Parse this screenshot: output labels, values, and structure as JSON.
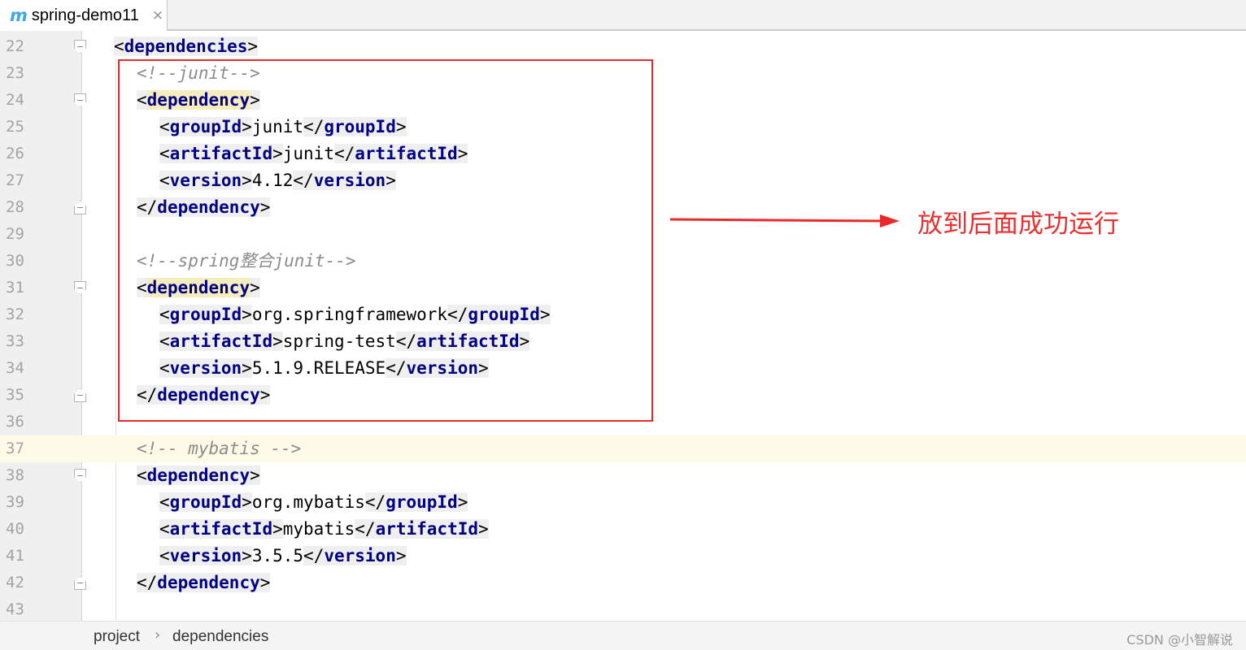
{
  "tab": {
    "logo": "m",
    "title": "spring-demo11",
    "close": "×"
  },
  "lines": [
    {
      "num": "22",
      "indent": 1,
      "fold": "open",
      "kind": "open",
      "tag": "dependencies"
    },
    {
      "num": "23",
      "indent": 2,
      "kind": "comment",
      "text": "<!--junit-->"
    },
    {
      "num": "24",
      "indent": 2,
      "fold": "open",
      "kind": "open",
      "tag": "dependency",
      "match": true
    },
    {
      "num": "25",
      "indent": 3,
      "kind": "element",
      "tag": "groupId",
      "text": "junit"
    },
    {
      "num": "26",
      "indent": 3,
      "kind": "element",
      "tag": "artifactId",
      "text": "junit"
    },
    {
      "num": "27",
      "indent": 3,
      "kind": "element",
      "tag": "version",
      "text": "4.12"
    },
    {
      "num": "28",
      "indent": 2,
      "fold": "close",
      "kind": "close",
      "tag": "dependency"
    },
    {
      "num": "29",
      "kind": "blank"
    },
    {
      "num": "30",
      "indent": 2,
      "kind": "comment",
      "text": "<!--spring整合junit-->"
    },
    {
      "num": "31",
      "indent": 2,
      "fold": "open",
      "kind": "open",
      "tag": "dependency",
      "match": true
    },
    {
      "num": "32",
      "indent": 3,
      "kind": "element",
      "tag": "groupId",
      "text": "org.springframework"
    },
    {
      "num": "33",
      "indent": 3,
      "kind": "element",
      "tag": "artifactId",
      "text": "spring-test"
    },
    {
      "num": "34",
      "indent": 3,
      "kind": "element",
      "tag": "version",
      "text": "5.1.9.RELEASE"
    },
    {
      "num": "35",
      "indent": 2,
      "fold": "close",
      "kind": "close",
      "tag": "dependency"
    },
    {
      "num": "36",
      "kind": "blank"
    },
    {
      "num": "37",
      "indent": 2,
      "kind": "comment",
      "text": "<!-- mybatis -->",
      "current": true
    },
    {
      "num": "38",
      "indent": 2,
      "fold": "open",
      "kind": "open",
      "tag": "dependency"
    },
    {
      "num": "39",
      "indent": 3,
      "kind": "element",
      "tag": "groupId",
      "text": "org.mybatis"
    },
    {
      "num": "40",
      "indent": 3,
      "kind": "element",
      "tag": "artifactId",
      "text": "mybatis"
    },
    {
      "num": "41",
      "indent": 3,
      "kind": "element",
      "tag": "version",
      "text": "3.5.5"
    },
    {
      "num": "42",
      "indent": 2,
      "fold": "close",
      "kind": "close",
      "tag": "dependency"
    },
    {
      "num": "43",
      "kind": "blank"
    }
  ],
  "annotation": {
    "text": "放到后面成功运行",
    "color": "#ea3030"
  },
  "breadcrumb": {
    "items": [
      "project",
      "dependencies"
    ],
    "separator": "›"
  },
  "watermark": "CSDN @小智解说",
  "colors": {
    "tag": "#000080",
    "comment": "#8c8c8c",
    "highlight": "#ea2a2a",
    "accent": "#3da7e8"
  }
}
